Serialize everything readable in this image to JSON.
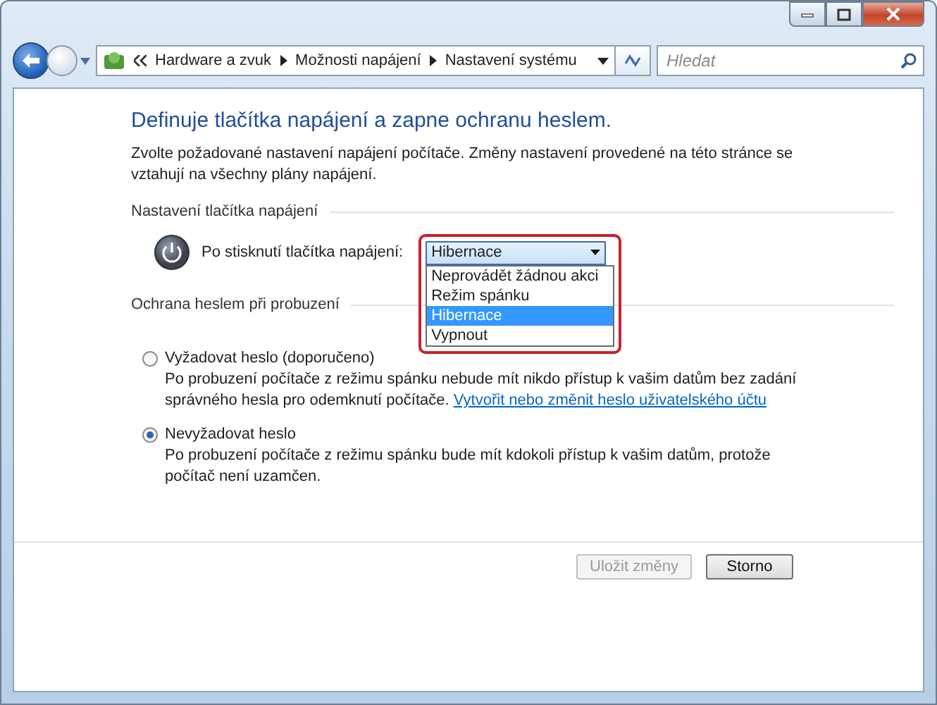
{
  "address_bar": {
    "crumbs": [
      "Hardware a zvuk",
      "Možnosti napájení",
      "Nastavení systému"
    ]
  },
  "search": {
    "placeholder": "Hledat"
  },
  "heading": "Definuje tlačítka napájení a zapne ochranu heslem.",
  "intro": "Zvolte požadované nastavení napájení počítače. Změny nastavení provedené na této stránce se vztahují na všechny plány napájení.",
  "power_button": {
    "section_title": "Nastavení tlačítka napájení",
    "label": "Po stisknutí tlačítka napájení:",
    "value": "Hibernace",
    "open": true,
    "options": [
      {
        "label": "Neprovádět žádnou akci",
        "selected": false
      },
      {
        "label": "Režim spánku",
        "selected": false
      },
      {
        "label": "Hibernace",
        "selected": true
      },
      {
        "label": "Vypnout",
        "selected": false
      }
    ]
  },
  "password": {
    "section_title": "Ochrana heslem při probuzení",
    "options": [
      {
        "label": "Vyžadovat heslo (doporučeno)",
        "selected": false,
        "description": "Po probuzení počítače z režimu spánku nebude mít nikdo přístup k vašim datům bez zadání správného hesla pro odemknutí počítače.",
        "link": "Vytvořit nebo změnit heslo uživatelského účtu"
      },
      {
        "label": "Nevyžadovat heslo",
        "selected": true,
        "description": "Po probuzení počítače z režimu spánku bude mít kdokoli přístup k vašim datům, protože počítač není uzamčen."
      }
    ]
  },
  "buttons": [
    {
      "label": "Uložit změny",
      "disabled": true
    },
    {
      "label": "Storno",
      "disabled": false
    }
  ]
}
